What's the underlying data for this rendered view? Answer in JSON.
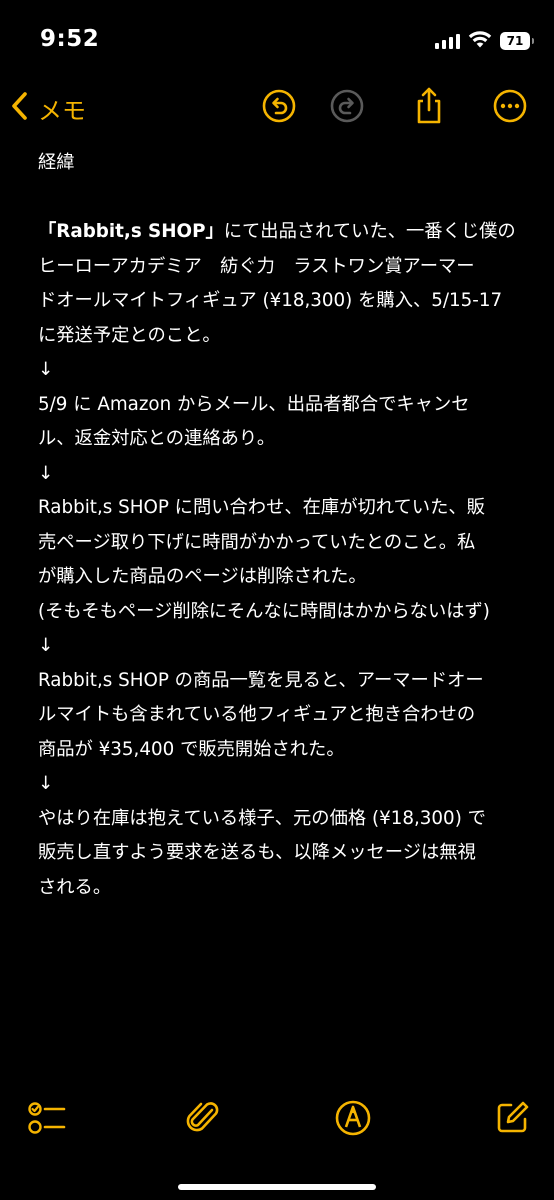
{
  "status_bar": {
    "time": "9:52",
    "battery": "71",
    "icons": [
      "signal-icon",
      "wifi-icon",
      "battery-icon"
    ]
  },
  "nav": {
    "back_label": "メモ",
    "icons": [
      "undo-icon",
      "redo-icon",
      "share-icon",
      "more-icon"
    ]
  },
  "note": {
    "lines": [
      {
        "segments": [
          {
            "text": "経緯"
          }
        ]
      },
      {
        "segments": [
          {
            "text": ""
          }
        ]
      },
      {
        "segments": [
          {
            "text": "「Rabbit,s SHOP」",
            "bold": true
          },
          {
            "text": "にて出品されていた、一番くじ僕の"
          }
        ]
      },
      {
        "segments": [
          {
            "text": "ヒーローアカデミア　紡ぐ力　ラストワン賞アーマー"
          }
        ]
      },
      {
        "segments": [
          {
            "text": "ドオールマイトフィギュア (¥18,300) を購入、5/15-17"
          }
        ]
      },
      {
        "segments": [
          {
            "text": "に発送予定とのこと。"
          }
        ]
      },
      {
        "segments": [
          {
            "text": "↓"
          }
        ]
      },
      {
        "segments": [
          {
            "text": "5/9 に Amazon からメール、出品者都合でキャンセ"
          }
        ]
      },
      {
        "segments": [
          {
            "text": "ル、返金対応との連絡あり。"
          }
        ]
      },
      {
        "segments": [
          {
            "text": "↓"
          }
        ]
      },
      {
        "segments": [
          {
            "text": "Rabbit,s SHOP に問い合わせ、在庫が切れていた、販"
          }
        ]
      },
      {
        "segments": [
          {
            "text": "売ページ取り下げに時間がかかっていたとのこと。私"
          }
        ]
      },
      {
        "segments": [
          {
            "text": "が購入した商品のページは削除された。"
          }
        ]
      },
      {
        "segments": [
          {
            "text": "(そもそもページ削除にそんなに時間はかからないはず)"
          }
        ]
      },
      {
        "segments": [
          {
            "text": "↓"
          }
        ]
      },
      {
        "segments": [
          {
            "text": "Rabbit,s SHOP の商品一覧を見ると、アーマードオー"
          }
        ]
      },
      {
        "segments": [
          {
            "text": "ルマイトも含まれている他フィギュアと抱き合わせの"
          }
        ]
      },
      {
        "segments": [
          {
            "text": "商品が ¥35,400 で販売開始された。"
          }
        ]
      },
      {
        "segments": [
          {
            "text": "↓"
          }
        ]
      },
      {
        "segments": [
          {
            "text": "やはり在庫は抱えている様子、元の価格 (¥18,300) で"
          }
        ]
      },
      {
        "segments": [
          {
            "text": "販売し直すよう要求を送るも、以降メッセージは無視"
          }
        ]
      },
      {
        "segments": [
          {
            "text": "される。"
          }
        ]
      }
    ]
  },
  "toolbar": {
    "icons": [
      "checklist-icon",
      "paperclip-icon",
      "markup-pen-icon",
      "compose-icon"
    ]
  },
  "colors": {
    "accent": "#f5b400",
    "background": "#000000",
    "text": "#ffffff",
    "disabled": "#5a5a5a"
  }
}
